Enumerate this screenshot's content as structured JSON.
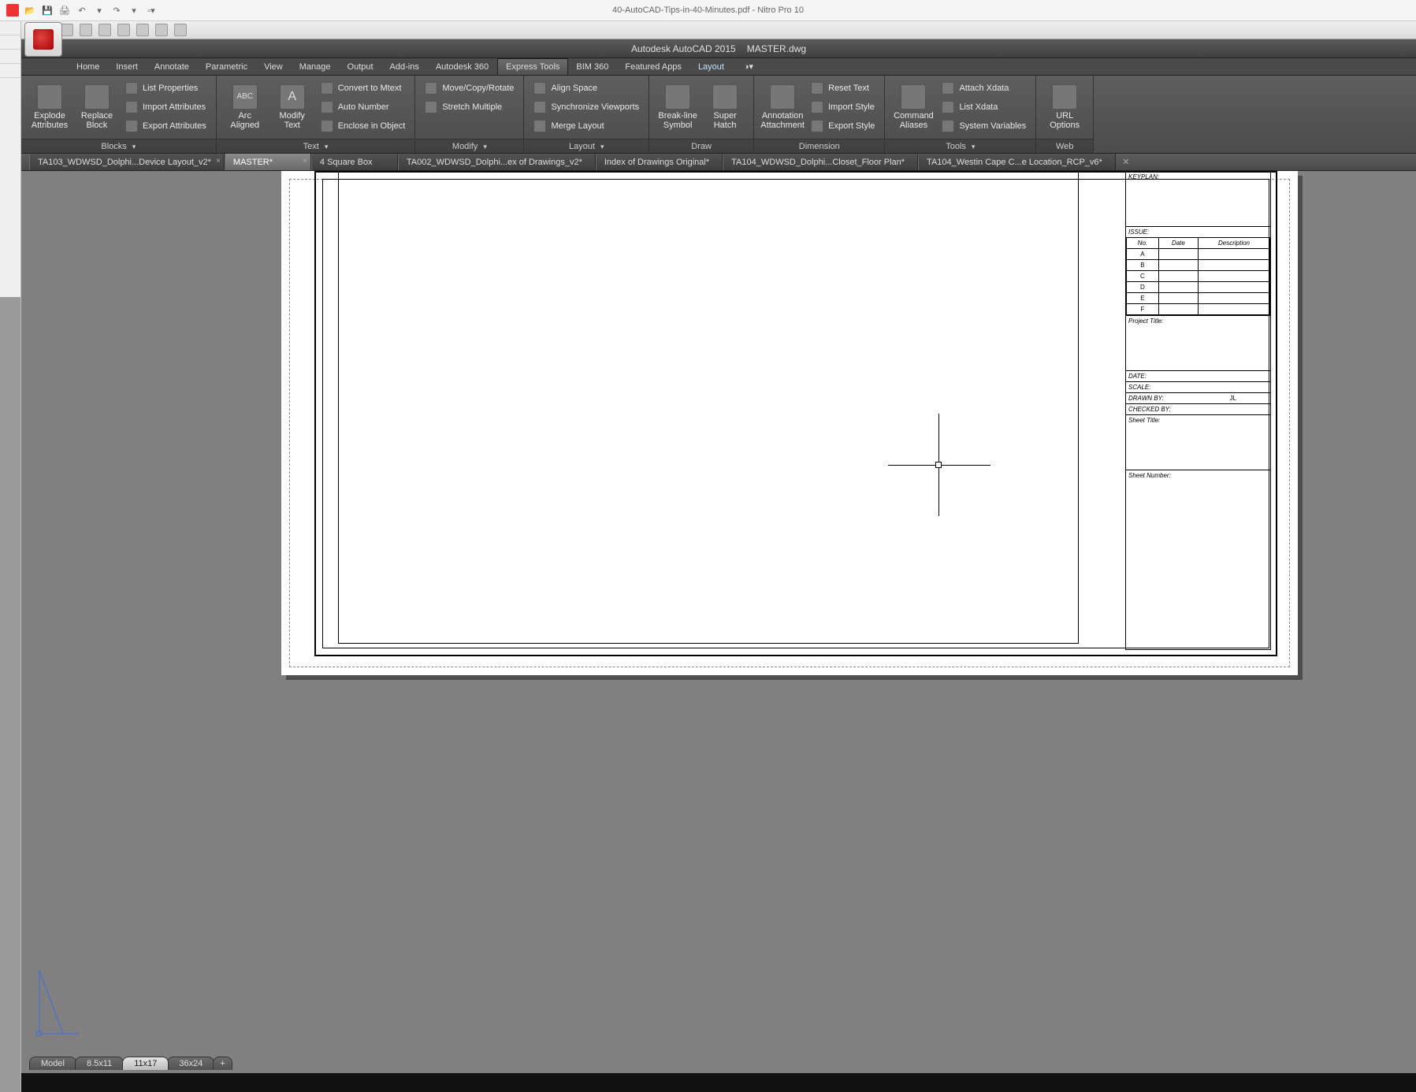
{
  "nitro": {
    "title": "40-AutoCAD-Tips-in-40-Minutes.pdf - Nitro Pro 10"
  },
  "acad": {
    "app_title": "Autodesk AutoCAD 2015",
    "doc_title": "MASTER.dwg",
    "ribbon_tabs": [
      "Home",
      "Insert",
      "Annotate",
      "Parametric",
      "View",
      "Manage",
      "Output",
      "Add-ins",
      "Autodesk 360",
      "Express Tools",
      "BIM 360",
      "Featured Apps",
      "Layout"
    ],
    "active_ribbon_tab": "Express Tools",
    "context_tab": "Layout"
  },
  "ribbon": {
    "blocks": {
      "title": "Blocks",
      "explode": "Explode\nAttributes",
      "replace": "Replace\nBlock",
      "list_props": "List Properties",
      "import_attrs": "Import Attributes",
      "export_attrs": "Export Attributes"
    },
    "text": {
      "title": "Text",
      "arc": "Arc\nAligned",
      "modify": "Modify\nText",
      "convert": "Convert to Mtext",
      "auto_num": "Auto Number",
      "enclose": "Enclose in Object"
    },
    "modify": {
      "title": "Modify",
      "move": "Move/Copy/Rotate",
      "stretch": "Stretch Multiple"
    },
    "layout": {
      "title": "Layout",
      "align": "Align Space",
      "sync": "Synchronize Viewports",
      "merge": "Merge Layout"
    },
    "draw": {
      "title": "Draw",
      "breakline": "Break-line\nSymbol",
      "superhatch": "Super\nHatch"
    },
    "dimension": {
      "title": "Dimension",
      "ann_attach": "Annotation\nAttachment",
      "reset": "Reset Text",
      "import_style": "Import Style",
      "export_style": "Export Style"
    },
    "tools": {
      "title": "Tools",
      "cmd_alias": "Command\nAliases",
      "attach_x": "Attach Xdata",
      "list_x": "List Xdata",
      "sys_vars": "System Variables"
    },
    "web": {
      "title": "Web",
      "url_opts": "URL\nOptions"
    }
  },
  "doc_tabs": [
    "TA103_WDWSD_Dolphi...Device Layout_v2*",
    "MASTER*",
    "4 Square Box",
    "TA002_WDWSD_Dolphi...ex of Drawings_v2*",
    "Index of Drawings Original*",
    "TA104_WDWSD_Dolphi...Closet_Floor Plan*",
    "TA104_Westin Cape C...e Location_RCP_v6*"
  ],
  "active_doc_tab": 1,
  "titleblock": {
    "keyplan": "KEYPLAN:",
    "issue": "ISSUE:",
    "cols": {
      "no": "No.",
      "date": "Date",
      "desc": "Description"
    },
    "rows": [
      "A",
      "B",
      "C",
      "D",
      "E",
      "F"
    ],
    "project_title": "Project Title:",
    "date": "DATE:",
    "scale": "SCALE:",
    "drawn_by_label": "DRAWN BY:",
    "drawn_by_val": "JL",
    "checked_by": "CHECKED BY:",
    "sheet_title": "Sheet Title:",
    "sheet_number": "Sheet Number:"
  },
  "layout_tabs": {
    "model": "Model",
    "t1": "8.5x11",
    "t2": "11x17",
    "t3": "36x24"
  }
}
